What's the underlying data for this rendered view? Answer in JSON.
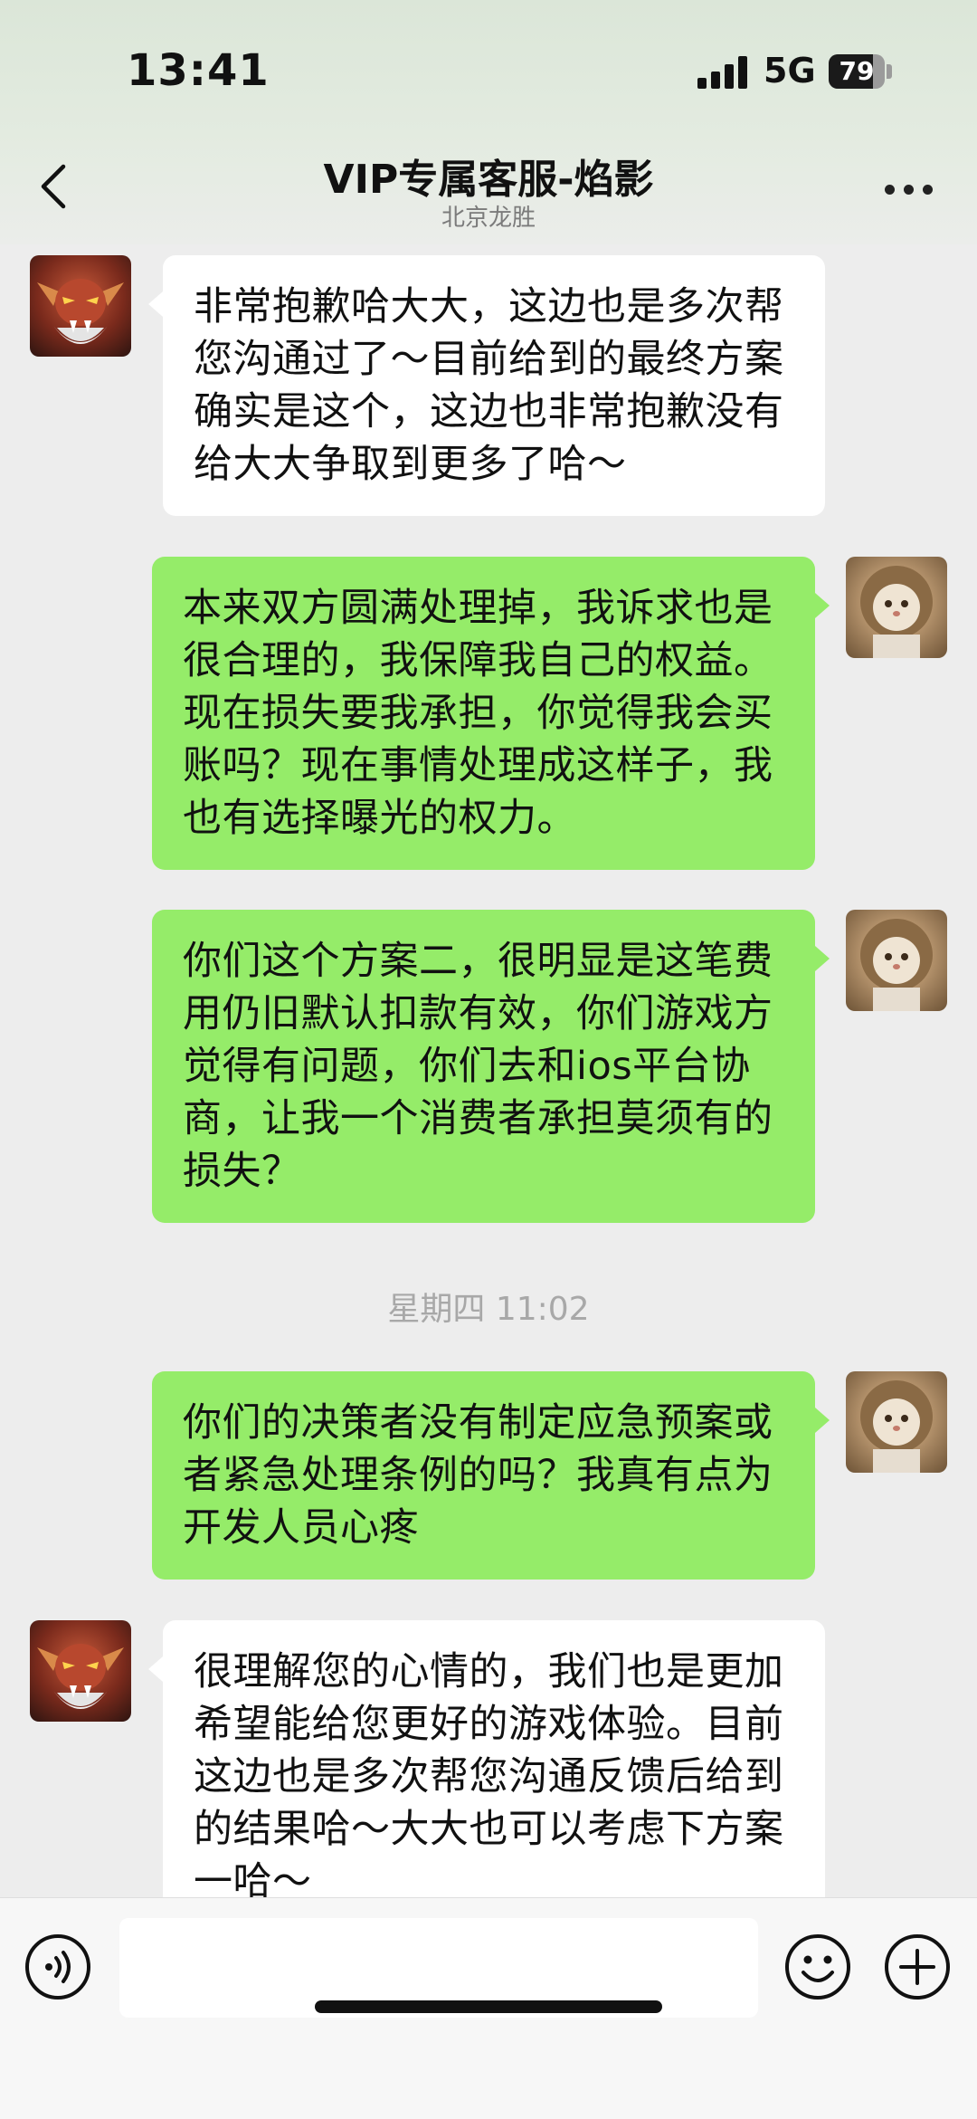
{
  "status_bar": {
    "time": "13:41",
    "network": "5G",
    "battery": "79",
    "battery_level": 0.79
  },
  "header": {
    "title": "VIP专属客服-焰影",
    "subtitle": "北京龙胜",
    "back_icon": "chevron-left-icon",
    "more_icon": "more-horizontal-icon"
  },
  "messages": [
    {
      "from": "agent",
      "text": "非常抱歉哈大大，这边也是多次帮您沟通过了～目前给到的最终方案确实是这个，这边也非常抱歉没有给大大争取到更多了哈～"
    },
    {
      "from": "me",
      "text": "本来双方圆满处理掉，我诉求也是很合理的，我保障我自己的权益。现在损失要我承担，你觉得我会买账吗？现在事情处理成这样子，我也有选择曝光的权力。"
    },
    {
      "from": "me",
      "text": "你们这个方案二，很明显是这笔费用仍旧默认扣款有效，你们游戏方觉得有问题，你们去和ios平台协商，让我一个消费者承担莫须有的损失？"
    },
    {
      "timestamp": "星期四 11:02"
    },
    {
      "from": "me",
      "text": "你们的决策者没有制定应急预案或者紧急处理条例的吗？我真有点为开发人员心疼"
    },
    {
      "from": "agent",
      "text": "很理解您的心情的，我们也是更加希望能给您更好的游戏体验。目前这边也是多次帮您沟通反馈后给到的结果哈～大大也可以考虑下方案一哈～"
    }
  ],
  "input_bar": {
    "placeholder": "",
    "voice_icon": "voice-icon",
    "emoji_icon": "emoji-icon",
    "plus_icon": "plus-icon"
  },
  "colors": {
    "outgoing_bubble": "#95ec69",
    "incoming_bubble": "#ffffff",
    "background": "#ededed"
  }
}
